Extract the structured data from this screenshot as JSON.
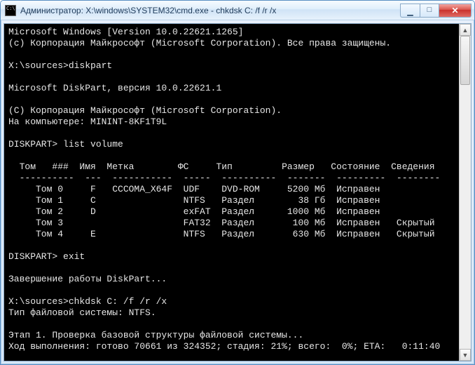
{
  "title": "Администратор: X:\\windows\\SYSTEM32\\cmd.exe - chkdsk  C: /f /r /x",
  "controls": {
    "min": "▁",
    "max": "□",
    "close": "✕"
  },
  "lines": {
    "l0": "Microsoft Windows [Version 10.0.22621.1265]",
    "l1": "(c) Корпорация Майкрософт (Microsoft Corporation). Все права защищены.",
    "l2": "",
    "l3": "X:\\sources>diskpart",
    "l4": "",
    "l5": "Microsoft DiskPart, версия 10.0.22621.1",
    "l6": "",
    "l7": "(C) Корпорация Майкрософт (Microsoft Corporation).",
    "l8": "На компьютере: MININT-8KF1T9L",
    "l9": "",
    "l10": "DISKPART> list volume",
    "l11": "",
    "l12": "  Том   ###  Имя  Метка        ФС     Тип         Размер   Состояние  Сведения",
    "l13": "  ----------  ---  -----------  -----  ----------  -------  ---------  --------",
    "l14": "     Том 0     F   CCCOMA_X64F  UDF    DVD-ROM     5200 Мб  Исправен",
    "l15": "     Том 1     C                NTFS   Раздел        38 Гб  Исправен",
    "l16": "     Том 2     D                exFAT  Раздел      1000 Мб  Исправен",
    "l17": "     Том 3                      FAT32  Раздел       100 Мб  Исправен   Скрытый",
    "l18": "     Том 4     E                NTFS   Раздел       630 Мб  Исправен   Скрытый",
    "l19": "",
    "l20": "DISKPART> exit",
    "l21": "",
    "l22": "Завершение работы DiskPart...",
    "l23": "",
    "l24": "X:\\sources>chkdsk C: /f /r /x",
    "l25": "Тип файловой системы: NTFS.",
    "l26": "",
    "l27": "Этап 1. Проверка базовой структуры файловой системы...",
    "l28": "Ход выполнения: готово 70661 из 324352; стадия: 21%; всего:  0%; ETA:   0:11:40"
  },
  "table": {
    "headers": [
      "Том",
      "###",
      "Имя",
      "Метка",
      "ФС",
      "Тип",
      "Размер",
      "Состояние",
      "Сведения"
    ],
    "rows": [
      {
        "tom": "Том 0",
        "letter": "F",
        "label": "CCCOMA_X64F",
        "fs": "UDF",
        "type": "DVD-ROM",
        "size": "5200 Мб",
        "state": "Исправен",
        "info": ""
      },
      {
        "tom": "Том 1",
        "letter": "C",
        "label": "",
        "fs": "NTFS",
        "type": "Раздел",
        "size": "38 Гб",
        "state": "Исправен",
        "info": ""
      },
      {
        "tom": "Том 2",
        "letter": "D",
        "label": "",
        "fs": "exFAT",
        "type": "Раздел",
        "size": "1000 Мб",
        "state": "Исправен",
        "info": ""
      },
      {
        "tom": "Том 3",
        "letter": "",
        "label": "",
        "fs": "FAT32",
        "type": "Раздел",
        "size": "100 Мб",
        "state": "Исправен",
        "info": "Скрытый"
      },
      {
        "tom": "Том 4",
        "letter": "E",
        "label": "",
        "fs": "NTFS",
        "type": "Раздел",
        "size": "630 Мб",
        "state": "Исправен",
        "info": "Скрытый"
      }
    ]
  },
  "scroll": {
    "up": "▲",
    "down": "▼"
  }
}
